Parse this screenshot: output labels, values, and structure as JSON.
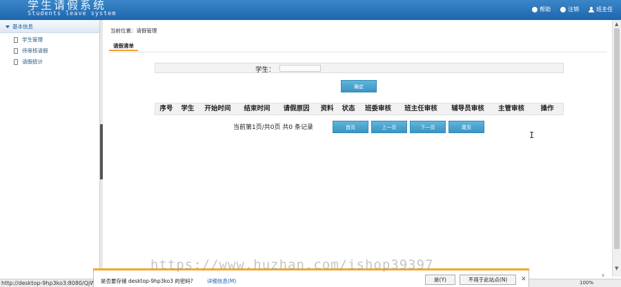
{
  "header": {
    "title": "学生请假系统",
    "subtitle": "Students leave system",
    "links": [
      {
        "icon": "help-icon",
        "label": "帮助"
      },
      {
        "icon": "power-icon",
        "label": "注销"
      },
      {
        "icon": "user-icon",
        "label": "班主任"
      }
    ]
  },
  "sidebar": {
    "group_label": "基本信息",
    "items": [
      {
        "label": "学生管理"
      },
      {
        "label": "待审核请假"
      },
      {
        "label": "请假统计"
      }
    ]
  },
  "main": {
    "breadcrumb": "当前位置：请假管理",
    "tab_label": "请假清单",
    "search": {
      "label": "学生：",
      "value": ""
    },
    "confirm_label": "确定",
    "table_headers": [
      "序号",
      "学生",
      "开始时间",
      "结束时间",
      "请假原因",
      "资料",
      "状态",
      "班委审核",
      "班主任审核",
      "辅导员审核",
      "主管审核",
      "操作"
    ],
    "pager": {
      "summary": "当前第1页/共0页 共0 条记录",
      "first": "首页",
      "prev": "上一页",
      "next": "下一页",
      "last": "尾页"
    }
  },
  "notification": {
    "message": "是否要存储 desktop-9hp3ko3 的密码?",
    "details": "详细信息(M)",
    "yes": "是(Y)",
    "never": "不用于此站点(N)"
  },
  "statusbar": {
    "url": "http://desktop-9hp3ko3:8080/QjW",
    "zoom": "100%"
  },
  "watermark": "https://www.huzhan.com/ishop39397",
  "colors": {
    "header": "#2a76bd",
    "button": "#46a3cf",
    "tab_accent": "#f0a030",
    "notify_accent": "#f5a623"
  }
}
